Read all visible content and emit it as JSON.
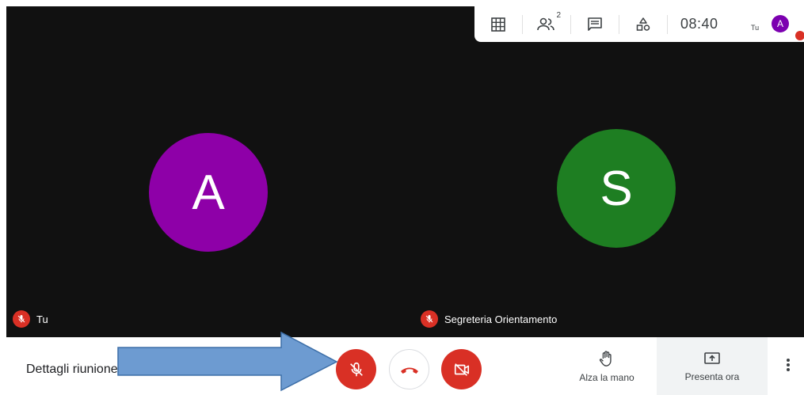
{
  "meeting": {
    "clock": "08:40",
    "participant_count": "2",
    "details_label": "Dettagli riunione"
  },
  "tiles": [
    {
      "initial": "A",
      "name": "Tu",
      "color": "#8e00a8",
      "muted": true
    },
    {
      "initial": "S",
      "name": "Segreteria Orientamento",
      "color": "#1e7e22",
      "muted": true
    }
  ],
  "self_mini": {
    "label": "Tu",
    "initial": "A"
  },
  "controls": {
    "raise_hand_label": "Alza la mano",
    "present_label": "Presenta ora",
    "mic_state": "off",
    "camera_state": "off"
  },
  "topbar_icons": [
    "grid-layout-icon",
    "people-icon",
    "chat-icon",
    "activities-icon"
  ],
  "colors": {
    "danger": "#d93025",
    "video_bg": "#111111",
    "annotation_arrow": "#6d9bd1"
  }
}
